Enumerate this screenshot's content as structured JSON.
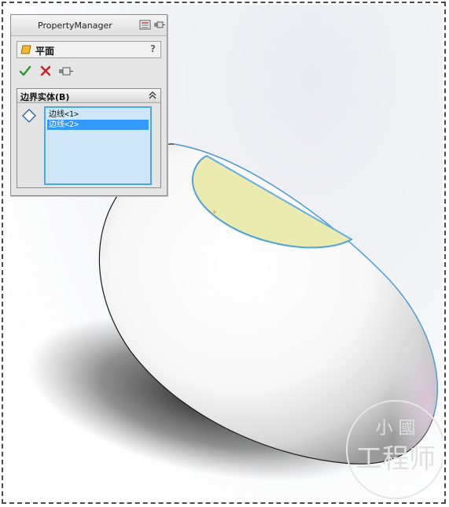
{
  "property_manager": {
    "title": "PropertyManager",
    "feature_name": "平面",
    "help": "?",
    "group": {
      "title": "边界实体(B)",
      "items": [
        "边线<1>",
        "边线<2>"
      ],
      "selected_index": 1
    }
  },
  "watermark": {
    "top_text": "小  國",
    "bottom_text": "工程师"
  },
  "colors": {
    "selection_fill": "#ebebb0",
    "selection_edge": "#4aa3e0",
    "list_bg": "#cfe5f8",
    "list_selected": "#3399ff",
    "ok_green": "#2e9a2e",
    "cancel_red": "#d02020"
  }
}
